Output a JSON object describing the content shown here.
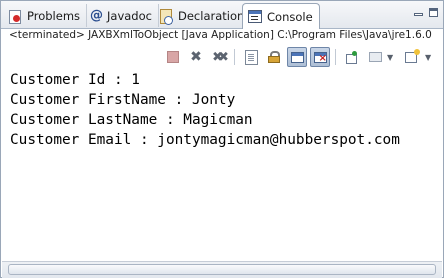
{
  "tabs": [
    {
      "label": "Problems",
      "icon": "problems-icon"
    },
    {
      "label": "Javadoc",
      "icon": "javadoc-icon"
    },
    {
      "label": "Declaration",
      "icon": "declaration-icon"
    },
    {
      "label": "Console",
      "icon": "console-icon",
      "active": true
    }
  ],
  "status_line": "<terminated> JAXBXmlToObject [Java Application] C:\\Program Files\\Java\\jre1.6.0",
  "toolbar_icons": [
    "terminate-icon",
    "remove-launch-icon",
    "remove-all-terminated-icon",
    "clear-console-icon",
    "scroll-lock-icon",
    "show-console-on-stdout-icon",
    "show-console-on-stderr-icon",
    "pin-console-icon",
    "display-selected-console-icon",
    "open-console-icon"
  ],
  "console_lines": [
    "Customer Id : 1",
    "Customer FirstName : Jonty",
    "Customer LastName : Magicman",
    "Customer Email : jontymagicman@hubberspot.com"
  ],
  "colors": {
    "tab_strip": "#e4e8ee",
    "border": "#9aa7b8",
    "console_text": "#000000"
  }
}
